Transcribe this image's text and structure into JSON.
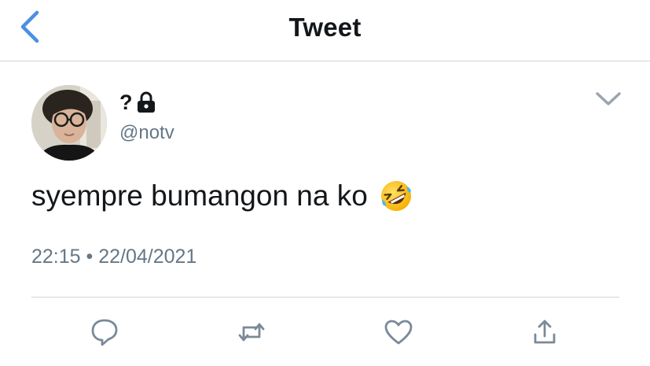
{
  "nav": {
    "title": "Tweet",
    "back_icon": "chevron-left-icon"
  },
  "tweet": {
    "display_name": "?",
    "protected_icon": "lock-icon",
    "handle": "@notv",
    "text": "syempre bumangon na ko",
    "emoji": "rolling-on-the-floor-laughing-emoji",
    "timestamp": "22:15 • 22/04/2021"
  },
  "actions": {
    "reply_icon": "reply-icon",
    "retweet_icon": "retweet-icon",
    "like_icon": "heart-icon",
    "share_icon": "share-icon",
    "menu_icon": "chevron-down-icon"
  },
  "colors": {
    "accent": "#4a90e2",
    "secondary_text": "#657786",
    "icon_gray": "#7a8a99",
    "divider": "#d3d6da"
  }
}
